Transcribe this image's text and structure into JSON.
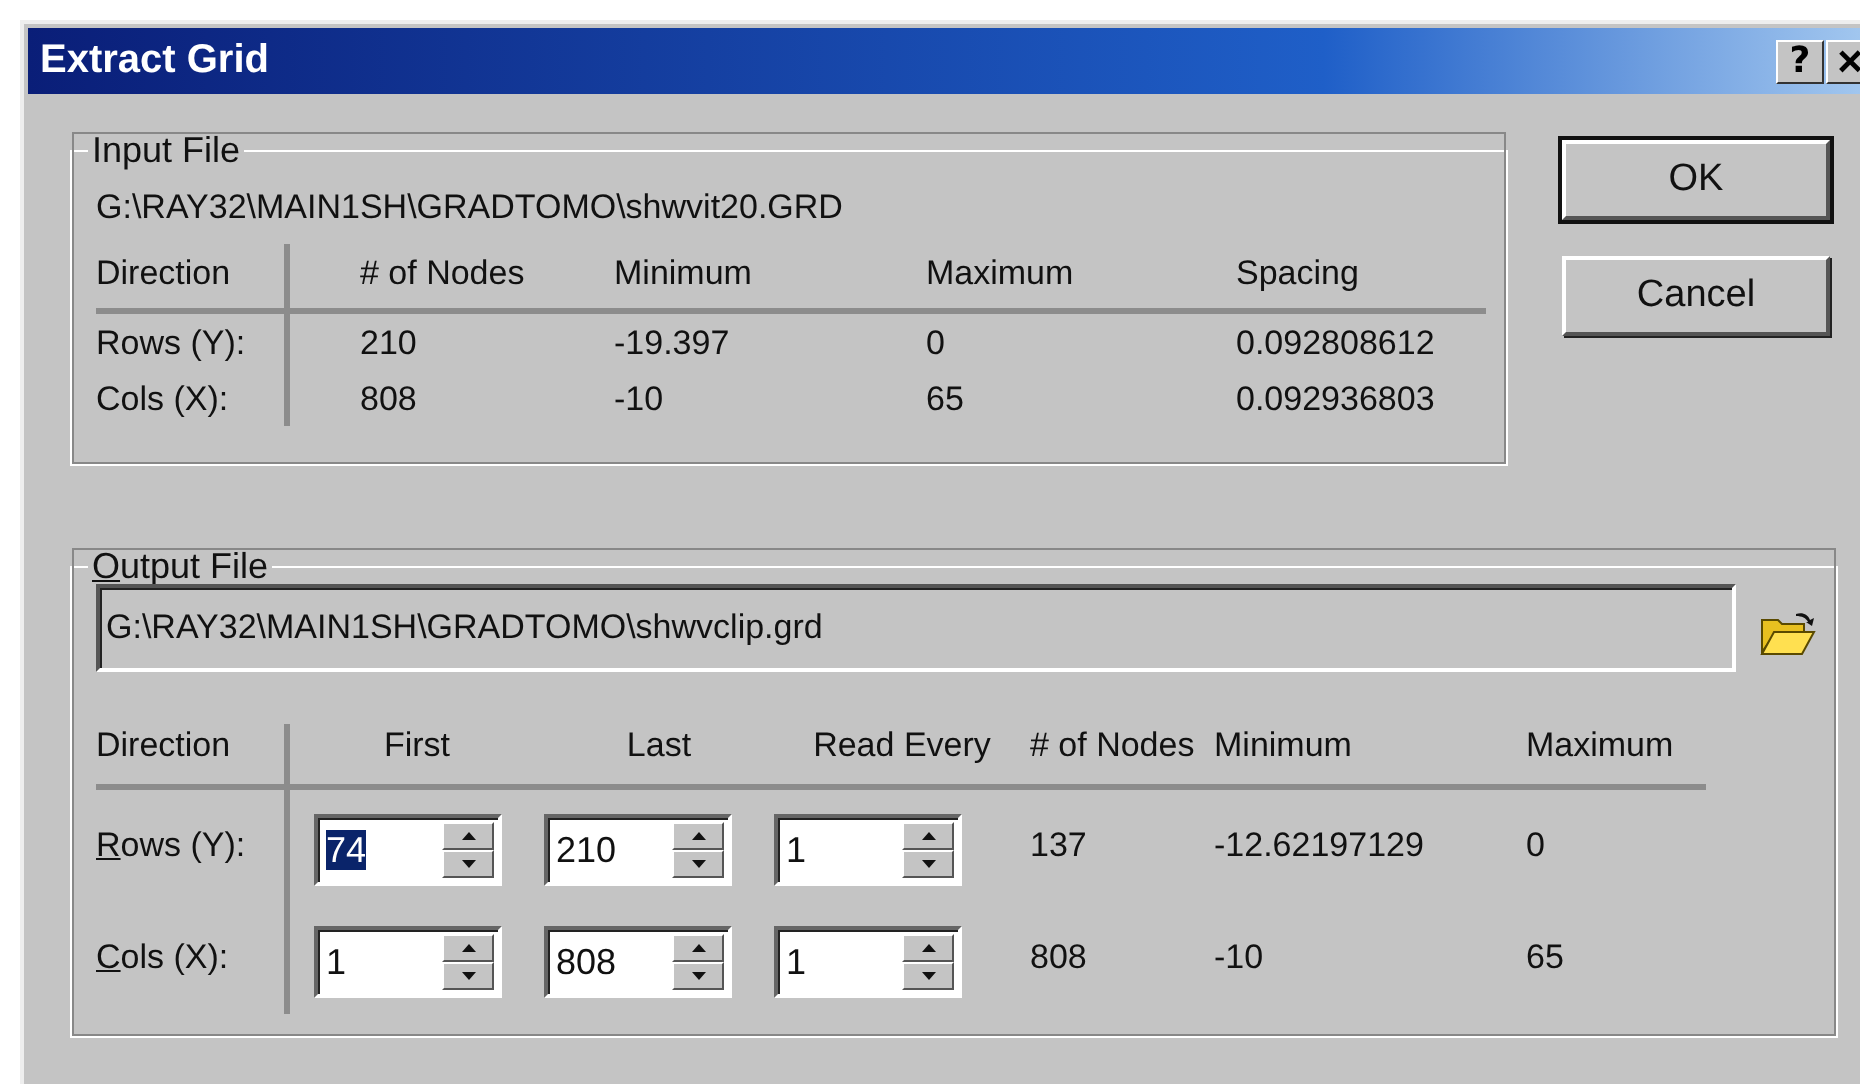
{
  "window": {
    "title": "Extract Grid",
    "title_buttons": [
      {
        "kind": "help",
        "label": "?"
      },
      {
        "kind": "close",
        "label": "×"
      }
    ]
  },
  "input_file": {
    "legend": "Input File",
    "path": "G:\\RAY32\\MAIN1SH\\GRADTOMO\\shwvit20.GRD",
    "columns": [
      "Direction",
      "# of Nodes",
      "Minimum",
      "Maximum",
      "Spacing"
    ],
    "rows": [
      {
        "direction": "Rows (Y):",
        "nodes": "210",
        "minimum": "-19.397",
        "maximum": "0",
        "spacing": "0.092808612"
      },
      {
        "direction": "Cols (X):",
        "nodes": "808",
        "minimum": "-10",
        "maximum": "65",
        "spacing": "0.092936803"
      }
    ]
  },
  "buttons": [
    {
      "label": "OK",
      "default": true
    },
    {
      "label": "Cancel",
      "default": false
    }
  ],
  "output_file": {
    "legend": "Output File",
    "legend_underline_first": true,
    "path": "G:\\RAY32\\MAIN1SH\\GRADTOMO\\shwvclip.grd",
    "columns": [
      "Direction",
      "First",
      "Last",
      "Read Every",
      "# of Nodes",
      "Minimum",
      "Maximum"
    ],
    "rows": [
      {
        "direction": "Rows (Y):",
        "underline_first": true,
        "first": {
          "value": "74",
          "text_selected": true
        },
        "last": {
          "value": "210",
          "text_selected": false
        },
        "read_every": {
          "value": "1",
          "text_selected": false
        },
        "nodes": "137",
        "minimum": "-12.62197129",
        "maximum": "0"
      },
      {
        "direction": "Cols (X):",
        "underline_first": true,
        "first": {
          "value": "1",
          "text_selected": false
        },
        "last": {
          "value": "808",
          "text_selected": false
        },
        "read_every": {
          "value": "1",
          "text_selected": false
        },
        "nodes": "808",
        "minimum": "-10",
        "maximum": "65"
      }
    ]
  }
}
